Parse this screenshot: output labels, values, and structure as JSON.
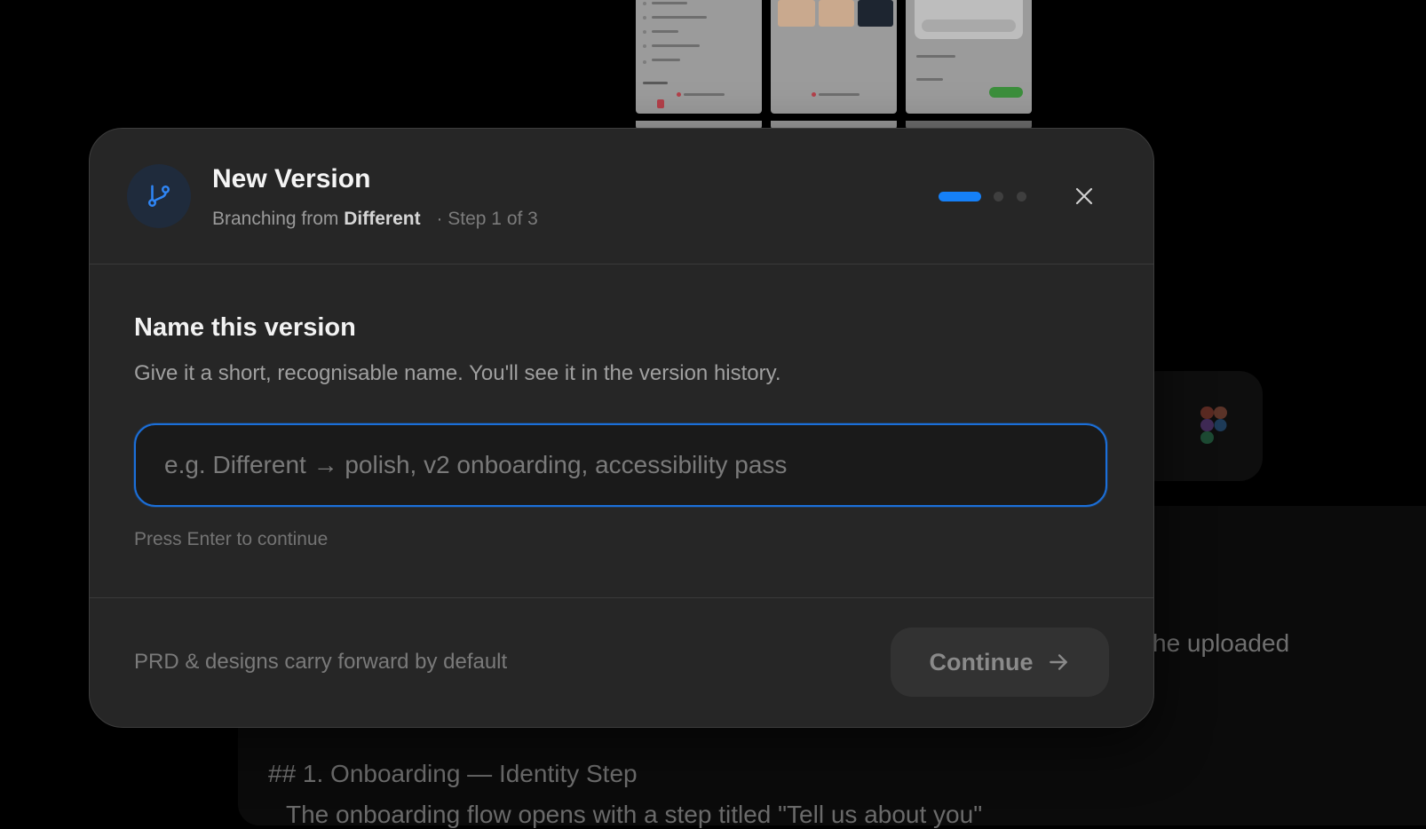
{
  "modal": {
    "title": "New Version",
    "subtitle_prefix": "Branching from",
    "source_version": "Different",
    "step_text": "· Step 1 of 3",
    "step_current": 1,
    "step_total": 3,
    "accent_color": "#1580f8",
    "body_title": "Name this version",
    "body_description": "Give it a short, recognisable name. You'll see it in the version history.",
    "input_value": "",
    "input_placeholder": "e.g. Different → polish, v2 onboarding, accessibility pass",
    "hint": "Press Enter to continue",
    "footer_note": "PRD & designs carry forward by default",
    "continue_label": "Continue",
    "icons": {
      "badge": "branch-icon",
      "close": "close-icon",
      "continue": "arrow-right-icon"
    }
  },
  "background": {
    "partial_text": "he uploaded",
    "heading": "## 1. Onboarding — Identity Step",
    "partial_line": "The onboarding flow opens with a step titled \"Tell us about you\"",
    "icons": {
      "app": "figma-icon"
    }
  }
}
